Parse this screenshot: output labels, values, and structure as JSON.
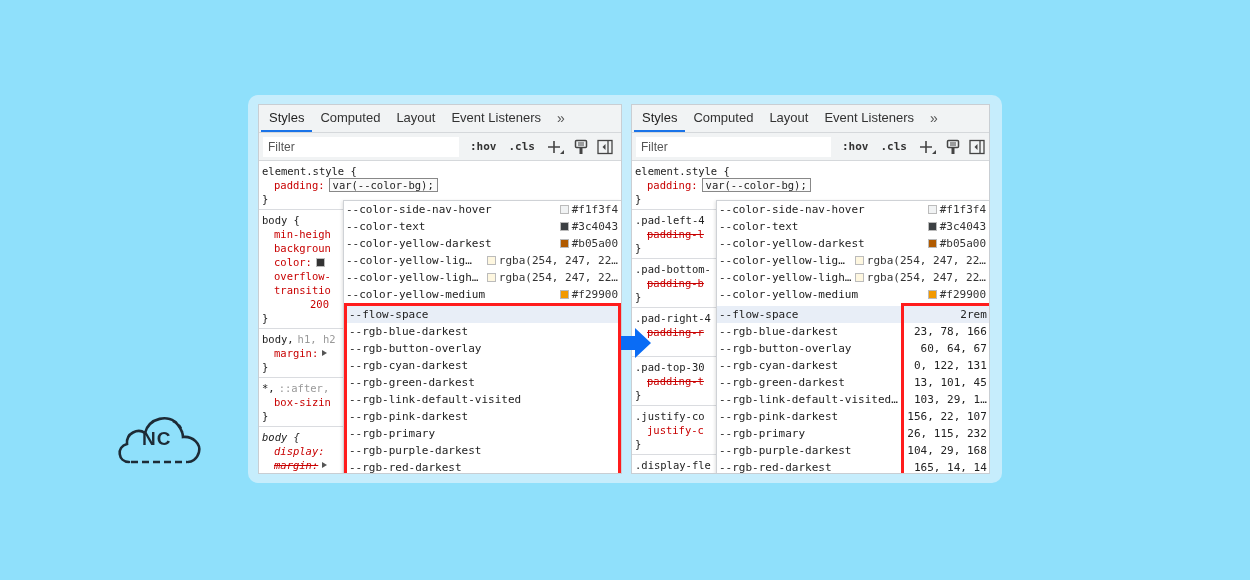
{
  "logo": {
    "text": "NC"
  },
  "panels": [
    {
      "tabs": [
        {
          "label": "Styles",
          "selected": true
        },
        {
          "label": "Computed",
          "selected": false
        },
        {
          "label": "Layout",
          "selected": false
        },
        {
          "label": "Event Listeners",
          "selected": false
        }
      ],
      "more_tabs": "»",
      "filter": {
        "placeholder": "Filter"
      },
      "toolbar": [
        ":hov",
        ".cls"
      ],
      "rules": [
        {
          "selector": "element.style {",
          "italic": false,
          "closing": "}",
          "declarations": [
            {
              "kind": "property",
              "name": "padding:",
              "value": "var(--color-bg);",
              "editing": true,
              "strike": false
            }
          ]
        },
        {
          "selector": "body {",
          "italic": false,
          "closing": "}",
          "declarations": [
            {
              "kind": "property",
              "name": "min-heigh",
              "strike": false
            },
            {
              "kind": "property",
              "name": "backgroun",
              "strike": false
            },
            {
              "kind": "property",
              "name": "color:",
              "color": "#333333",
              "strike": false
            },
            {
              "kind": "property",
              "name": "overflow-",
              "strike": false
            },
            {
              "kind": "property",
              "name": "transitio",
              "strike": false
            },
            {
              "kind": "continuation",
              "name": "200",
              "strike": false
            }
          ]
        },
        {
          "selector": "body,",
          "selector_extra": "h1, h2",
          "italic": false,
          "closing": "}",
          "declarations": [
            {
              "kind": "property",
              "name": "margin:",
              "strike": false,
              "expander": true
            }
          ]
        },
        {
          "selector": "*,",
          "selector_extra": "::after,",
          "italic": false,
          "closing": "}",
          "declarations": [
            {
              "kind": "property",
              "name": "box-sizin",
              "strike": false
            }
          ]
        },
        {
          "selector": "body {",
          "italic": true,
          "declarations": [
            {
              "kind": "property",
              "name": "display:",
              "strike": false
            },
            {
              "kind": "property",
              "name": "margin:",
              "strike": true,
              "expander": true
            }
          ]
        }
      ],
      "dropdown": {
        "kind": "rows",
        "items": [
          {
            "name": "--color-side-nav-hover",
            "color": "#f1f3f4",
            "value": "#f1f3f4",
            "selected": false
          },
          {
            "name": "--color-text",
            "color": "#3c4043",
            "value": "#3c4043",
            "selected": false
          },
          {
            "name": "--color-yellow-darkest",
            "color": "#b05a00",
            "value": "#b05a00",
            "selected": false
          },
          {
            "name": "--color-yellow-lig…",
            "color": "#fef7e0",
            "value": "rgba(254, 247, 22…",
            "selected": false
          },
          {
            "name": "--color-yellow-ligh…",
            "color": "#fef7e0",
            "value": "rgba(254, 247, 22…",
            "selected": false
          },
          {
            "name": "--color-yellow-medium",
            "color": "#f29900",
            "value": "#f29900",
            "selected": false
          }
        ],
        "framed_items": [
          {
            "name": "--flow-space",
            "selected": true
          },
          {
            "name": "--rgb-blue-darkest",
            "selected": false
          },
          {
            "name": "--rgb-button-overlay",
            "selected": false
          },
          {
            "name": "--rgb-cyan-darkest",
            "selected": false
          },
          {
            "name": "--rgb-green-darkest",
            "selected": false
          },
          {
            "name": "--rgb-link-default-visited",
            "selected": false
          },
          {
            "name": "--rgb-pink-darkest",
            "selected": false
          },
          {
            "name": "--rgb-primary",
            "selected": false
          },
          {
            "name": "--rgb-purple-darkest",
            "selected": false
          },
          {
            "name": "--rgb-red-darkest",
            "selected": false
          }
        ]
      }
    },
    {
      "tabs": [
        {
          "label": "Styles",
          "selected": true
        },
        {
          "label": "Computed",
          "selected": false
        },
        {
          "label": "Layout",
          "selected": false
        },
        {
          "label": "Event Listeners",
          "selected": false
        }
      ],
      "more_tabs": "»",
      "filter": {
        "placeholder": "Filter"
      },
      "toolbar": [
        ":hov",
        ".cls"
      ],
      "rules": [
        {
          "selector": "element.style {",
          "italic": false,
          "closing": "}",
          "declarations": [
            {
              "kind": "property",
              "name": "padding:",
              "value": "var(--color-bg);",
              "editing": true,
              "strike": false
            }
          ]
        },
        {
          "selector": ".pad-left-4",
          "italic": false,
          "closing": "}",
          "declarations": [
            {
              "kind": "property",
              "name": "padding-l",
              "strike": true
            }
          ]
        },
        {
          "selector": ".pad-bottom-",
          "italic": false,
          "closing": "}",
          "declarations": [
            {
              "kind": "property",
              "name": "padding-b",
              "strike": true
            }
          ]
        },
        {
          "selector": ".pad-right-4",
          "italic": false,
          "declarations": [
            {
              "kind": "property",
              "name": "padding-r",
              "strike": true
            }
          ]
        },
        {
          "selector": ".pad-top-30",
          "italic": false,
          "closing": "}",
          "declarations": [
            {
              "kind": "property",
              "name": "padding-t",
              "strike": true
            }
          ]
        },
        {
          "selector": ".justify-co",
          "italic": false,
          "closing": "}",
          "declarations": [
            {
              "kind": "property",
              "name": "justify-c",
              "strike": false
            }
          ]
        },
        {
          "selector": ".display-fle",
          "italic": false
        }
      ],
      "dropdown": {
        "kind": "values",
        "items": [
          {
            "name": "--color-side-nav-hover",
            "color": "#f1f3f4",
            "value": "#f1f3f4",
            "selected": false
          },
          {
            "name": "--color-text",
            "color": "#3c4043",
            "value": "#3c4043",
            "selected": false
          },
          {
            "name": "--color-yellow-darkest",
            "color": "#b05a00",
            "value": "#b05a00",
            "selected": false
          },
          {
            "name": "--color-yellow-lig…",
            "color": "#fef7e0",
            "value": "rgba(254, 247, 22…",
            "selected": false
          },
          {
            "name": "--color-yellow-ligh…",
            "color": "#fef7e0",
            "value": "rgba(254, 247, 22…",
            "selected": false
          },
          {
            "name": "--color-yellow-medium",
            "color": "#f29900",
            "value": "#f29900",
            "selected": false
          }
        ],
        "framed_items": [
          {
            "name": "--flow-space",
            "value": "2rem",
            "selected": true
          },
          {
            "name": "--rgb-blue-darkest",
            "value": "23, 78, 166",
            "selected": false
          },
          {
            "name": "--rgb-button-overlay",
            "value": "60, 64, 67",
            "selected": false
          },
          {
            "name": "--rgb-cyan-darkest",
            "value": "0, 122, 131",
            "selected": false
          },
          {
            "name": "--rgb-green-darkest",
            "value": "13, 101, 45",
            "selected": false
          },
          {
            "name": "--rgb-link-default-visited…",
            "value": "103, 29, 1…",
            "selected": false
          },
          {
            "name": "--rgb-pink-darkest",
            "value": "156, 22, 107",
            "selected": false
          },
          {
            "name": "--rgb-primary",
            "value": "26, 115, 232",
            "selected": false
          },
          {
            "name": "--rgb-purple-darkest",
            "value": "104, 29, 168",
            "selected": false
          },
          {
            "name": "--rgb-red-darkest",
            "value": "165, 14, 14",
            "selected": false
          }
        ]
      }
    }
  ]
}
